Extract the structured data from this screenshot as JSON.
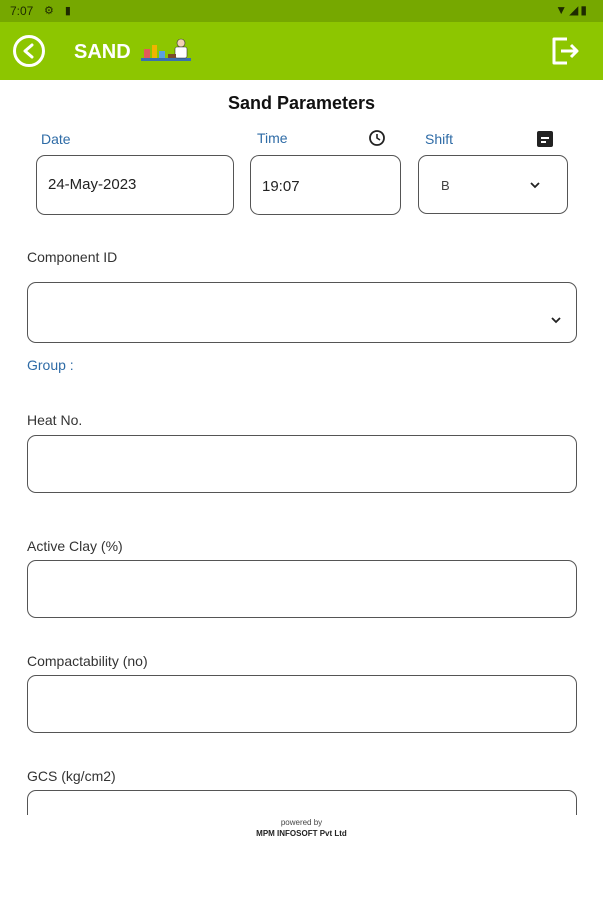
{
  "status_bar": {
    "time": "7:07"
  },
  "app_bar": {
    "title": "SAND"
  },
  "page": {
    "title": "Sand Parameters"
  },
  "date": {
    "label": "Date",
    "value": "24-May-2023"
  },
  "time": {
    "label": "Time",
    "value": "19:07"
  },
  "shift": {
    "label": "Shift",
    "value": "B"
  },
  "component": {
    "label": "Component ID",
    "value": ""
  },
  "group": {
    "label": "Group :"
  },
  "heat_no": {
    "label": "Heat No.",
    "value": ""
  },
  "active_clay": {
    "label": "Active Clay (%)",
    "value": ""
  },
  "compactability": {
    "label": "Compactability (no)",
    "value": ""
  },
  "gcs": {
    "label": "GCS (kg/cm2)",
    "value": ""
  },
  "footer": {
    "powered": "powered by",
    "company": "MPM INFOSOFT Pvt Ltd"
  },
  "colors": {
    "appbar": "#8dc600",
    "statusbar": "#76a800",
    "label_blue": "#2e6ba6"
  },
  "icons": [
    "back-icon",
    "logo-icon",
    "logout-icon",
    "clock-icon",
    "calendar-icon",
    "chevron-down-icon",
    "wifi-icon",
    "signal-icon",
    "battery-icon"
  ]
}
